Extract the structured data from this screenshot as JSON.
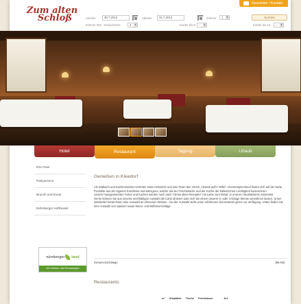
{
  "header": {
    "logo_line1": "Zum alten",
    "logo_line2": "Schloß",
    "newsletter_label": "Newsletter / Kontakt",
    "booking": {
      "arrival_label": "Anreise",
      "arrival_value": "30.7.2013",
      "departure_label": "Abreise",
      "departure_value": "31.7.2013",
      "rooms_label": "Zimmer",
      "rooms_value": "1",
      "room1_label": "Zimmer #01:",
      "adults_label": "Erwachsene",
      "adults_value": "2",
      "children_label": "Kinder bis 6:",
      "children_value": "-",
      "children14_label": "Kinder bis 14:",
      "children14_value": "-",
      "search_label": "Suchen"
    }
  },
  "nav": {
    "tabs": [
      {
        "label": "Hotel",
        "color": "#a8322e"
      },
      {
        "label": "Restaurant",
        "color": "#ee9a1d"
      },
      {
        "label": "Tagung",
        "color": "#eebd79"
      },
      {
        "label": "Urlaub",
        "color": "#96ae66"
      }
    ]
  },
  "sidebar": {
    "items": [
      {
        "label": "Ihre Feier"
      },
      {
        "label": "Partyservice"
      },
      {
        "label": "Brunch und Event"
      },
      {
        "label": "Dehnberger Hoftheater"
      }
    ],
    "badge_main": "nürnberger",
    "badge_land": "land",
    "badge_sub": "Wo Outdoor- und Genussregion"
  },
  "main": {
    "title": "Genießen in Kleedorf",
    "body": "Als Diätkoch und Küchenmeister vertreten Hans Heberlein und sein Team den Verein „Heimat auf'm Teller\". Dementsprechend finden sich auf der Karte Produkte aus der eigenen Konditorei und Metzgerei, welche mit der Frischeküche und der Küche der italienischen Leichtigkeit konkurrieren.",
    "body2": "Unsere hausgemachten Torten und Kuchen werden noch nach \"Omas alten Rezepten\" mit Liebe zum Detail, in unserer Hausbäckerei zubereitet.",
    "body3": "Gerne können Sie aus unserer reichhaltigen Auswahl als Carte dinieren oder sich bei einem unserer 3- oder 4-Gänge Menüs verwöhnen lassen. Unser Weinkeller bietet Ihnen eine Auswahl an erlesenen Weinen - bei der Auswahl steht unser erfahrenes Serviceteam gerne zur Verfügung. Unten finden Sie eine Auswahl von Speisen sowie Menü- und Buffetvorschläge.",
    "download_label": "menuevorschlaege",
    "download_size": "[66 KB]",
    "restaurants_title": "Restaurants",
    "table_headers": [
      "m²",
      "Sitzplätze",
      "Tische",
      "Preisklasse",
      "Art"
    ]
  }
}
